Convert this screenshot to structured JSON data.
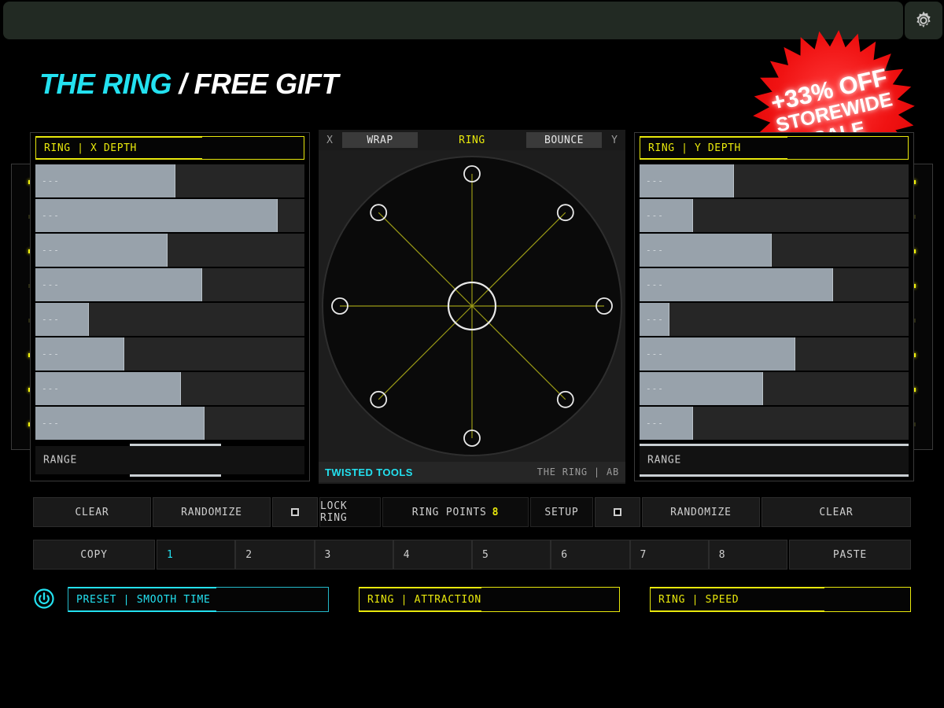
{
  "window": {
    "topbar_title": "",
    "gear_icon": "gear-icon"
  },
  "header": {
    "title_accent": "THE RING",
    "title_rest": " / FREE GIFT"
  },
  "promo": {
    "line1": "+33% OFF",
    "line2": "STOREWIDE",
    "line3": "SALE",
    "badge_color": "#ee1111",
    "text_color": "#ffffff"
  },
  "colors": {
    "accent_cyan": "#23e1f0",
    "accent_yellow": "#e8e80c",
    "slider_fill": "#98a2ab",
    "slider_track": "#262626"
  },
  "left_panel": {
    "header_label": "RING | X DEPTH",
    "header_fill_pct": 62,
    "sliders": [
      {
        "label": "---",
        "value_pct": 52
      },
      {
        "label": "---",
        "value_pct": 90
      },
      {
        "label": "---",
        "value_pct": 49
      },
      {
        "label": "---",
        "value_pct": 62
      },
      {
        "label": "---",
        "value_pct": 20
      },
      {
        "label": "---",
        "value_pct": 33
      },
      {
        "label": "---",
        "value_pct": 54
      },
      {
        "label": "---",
        "value_pct": 63
      }
    ],
    "leds": [
      true,
      false,
      true,
      false,
      false,
      true,
      true,
      true
    ],
    "range_label": "RANGE",
    "range_start_pct": 35,
    "range_width_pct": 34
  },
  "right_panel": {
    "header_label": "RING | Y DEPTH",
    "header_fill_pct": 55,
    "sliders": [
      {
        "label": "---",
        "value_pct": 35
      },
      {
        "label": "---",
        "value_pct": 20
      },
      {
        "label": "---",
        "value_pct": 49
      },
      {
        "label": "---",
        "value_pct": 72
      },
      {
        "label": "---",
        "value_pct": 11
      },
      {
        "label": "---",
        "value_pct": 58
      },
      {
        "label": "---",
        "value_pct": 46
      },
      {
        "label": "---",
        "value_pct": 20
      }
    ],
    "leds": [
      true,
      false,
      true,
      true,
      false,
      true,
      true,
      false
    ],
    "range_label": "RANGE",
    "range_start_pct": 0,
    "range_width_pct": 100
  },
  "ring_panel": {
    "axis_left": "X",
    "axis_right": "Y",
    "mode_wrap": "WRAP",
    "mode_ring": "RING",
    "mode_bounce": "BOUNCE",
    "brand": "TWISTED TOOLS",
    "preset_name": "THE RING | AB",
    "points": 8,
    "point_radius_pct": [
      100,
      100,
      100,
      100,
      100,
      100,
      100,
      100
    ]
  },
  "toolbar_primary": {
    "clear_left": "CLEAR",
    "randomize_left": "RANDOMIZE",
    "square_left": "",
    "lock_ring": "LOCK RING",
    "ring_points_label": "RING POINTS",
    "ring_points_value": "8",
    "setup": "SETUP",
    "square_right": "",
    "randomize_right": "RANDOMIZE",
    "clear_right": "CLEAR"
  },
  "toolbar_presets": {
    "copy": "COPY",
    "slots": [
      "1",
      "2",
      "3",
      "4",
      "5",
      "6",
      "7",
      "8"
    ],
    "active_slot": "1",
    "paste": "PASTE"
  },
  "bottom_params": [
    {
      "label": "PRESET | SMOOTH TIME",
      "accent": "cyan",
      "fill_pct": 57
    },
    {
      "label": "RING | ATTRACTION",
      "accent": "yellow",
      "fill_pct": 47
    },
    {
      "label": "RING | SPEED",
      "accent": "yellow",
      "fill_pct": 67
    }
  ],
  "power_button": {
    "icon": "power-icon",
    "state": "on"
  }
}
